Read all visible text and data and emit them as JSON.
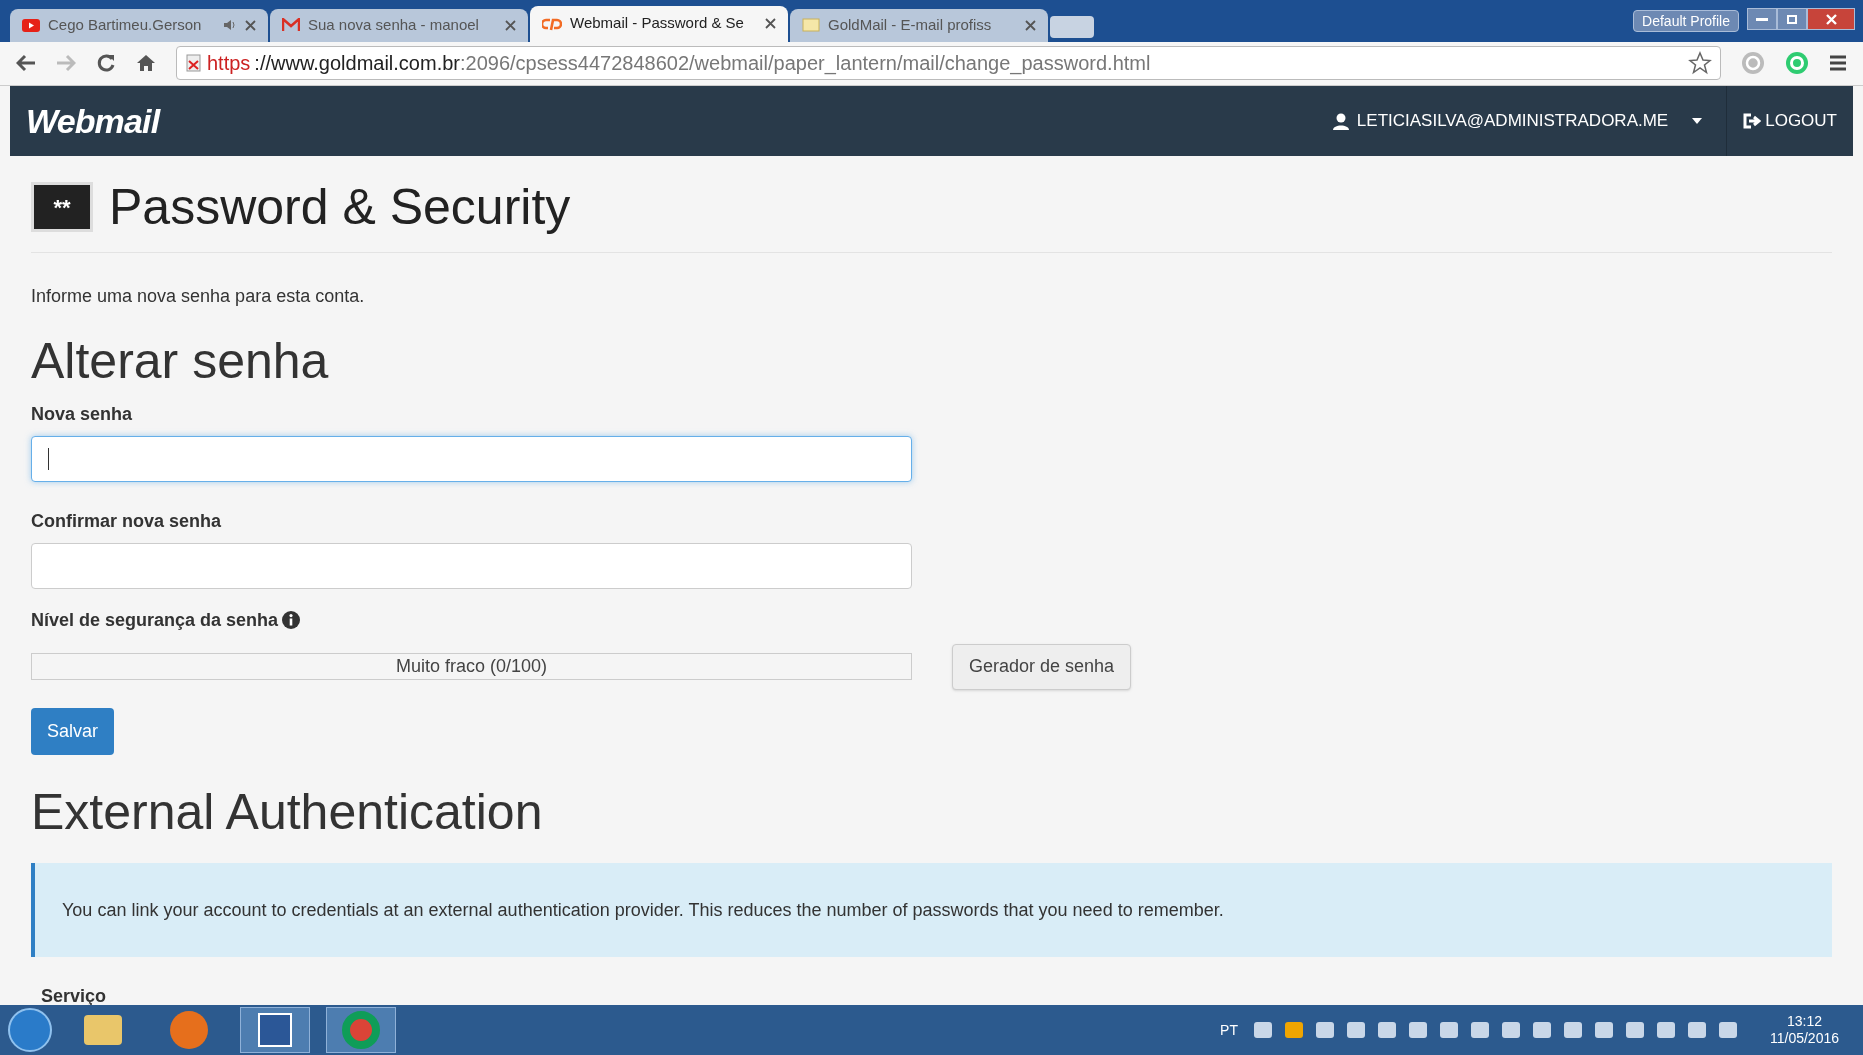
{
  "browser": {
    "tabs": [
      {
        "title": "Cego Bartimeu.Gerson",
        "kind": "youtube",
        "audio": true,
        "selected": false
      },
      {
        "title": "Sua nova senha - manoel",
        "kind": "gmail",
        "audio": false,
        "selected": false
      },
      {
        "title": "Webmail - Password & Se",
        "kind": "cpanel",
        "audio": false,
        "selected": true
      },
      {
        "title": "GoldMail - E-mail profiss",
        "kind": "goldmail",
        "audio": false,
        "selected": false
      }
    ],
    "profile": "Default Profile",
    "url": {
      "insecure": true,
      "scheme": "https",
      "host": "://www.goldmail.com.br",
      "path": ":2096/cpsess4472848602/webmail/paper_lantern/mail/change_password.html"
    }
  },
  "header": {
    "logo": "Webmail",
    "user": "LETICIASILVA@ADMINISTRADORA.ME",
    "logout": "LOGOUT"
  },
  "page": {
    "icon_text": "**",
    "title": "Password & Security",
    "intro": "Informe uma nova senha para esta conta.",
    "section": "Alterar senha",
    "fields": [
      {
        "label": "Nova senha",
        "focused": true
      },
      {
        "label": "Confirmar nova senha",
        "focused": false
      }
    ],
    "strength": {
      "label": "Nível de segurança da senha",
      "reading": "Muito fraco (0/100)",
      "level": 0
    },
    "generator": "Gerador de senha",
    "save": "Salvar",
    "external_title": "External Authentication",
    "external_info": "You can link your account to credentials at an external authentication provider. This reduces the number of passwords that you need to remember.",
    "service_label": "Serviço"
  },
  "taskbar": {
    "language": "PT",
    "time": "13:12",
    "date": "11/05/2016"
  }
}
